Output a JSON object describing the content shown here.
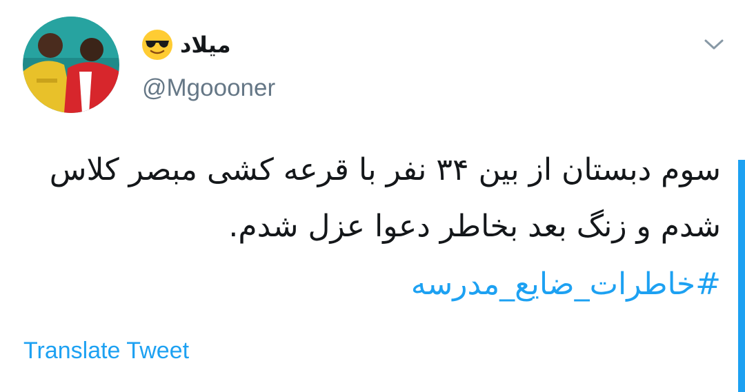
{
  "tweet": {
    "display_name": "میلاد",
    "handle": "@Mgoooner",
    "body": "سوم دبستان از بین ۳۴ نفر با قرعه کشی مبصر کلاس شدم و زنگ بعد بخاطر دعوا عزل شدم.",
    "hashtag": "#خاطرات_ضایع_مدرسه",
    "translate_label": "Translate Tweet",
    "emoji": "sunglasses-emoji"
  },
  "icons": {
    "menu": "chevron-down-icon"
  },
  "colors": {
    "text": "#14171a",
    "muted": "#657786",
    "link": "#1da1f2",
    "background": "#ffffff"
  }
}
